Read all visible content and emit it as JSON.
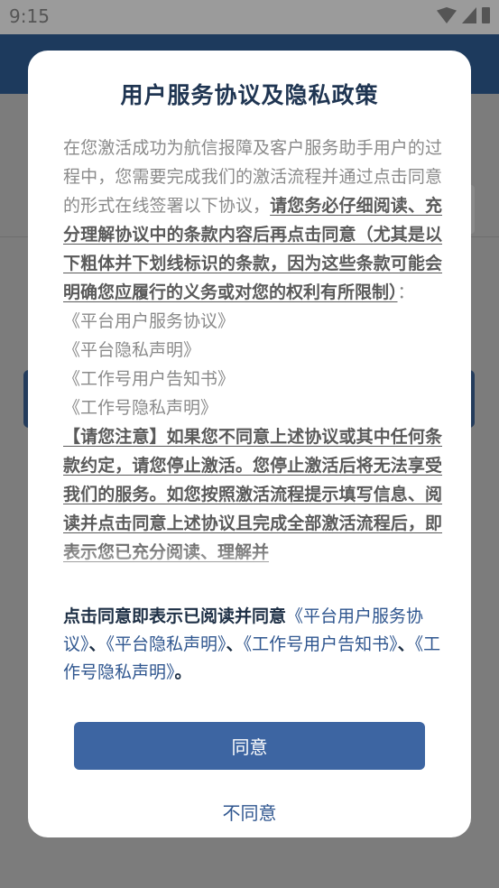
{
  "status_bar": {
    "time": "9:15"
  },
  "dialog": {
    "title": "用户服务协议及隐私政策",
    "intro": "在您激活成功为航信报障及客户服务助手用户的过程中，您需要完成我们的激活流程并通过点击同意的形式在线签署以下协议，",
    "intro_strong": "请您务必仔细阅读、充分理解协议中的条款内容后再点击同意（尤其是以下粗体并下划线标识的条款，因为这些条款可能会明确您应履行的义务或对您的权利有所限制）",
    "intro_tail": "：",
    "agreements": [
      "《平台用户服务协议》",
      "《平台隐私声明》",
      "《工作号用户告知书》",
      "《工作号隐私声明》"
    ],
    "notice_strong": "【请您注意】如果您不同意上述协议或其中任何条款约定，请您停止激活。您停止激活后将无法享受我们的服务。如您按照激活流程提示填写信息、阅读并点击同意上述协议且完成全部激活流程后，即表示您已充分阅读、理解并",
    "summary": {
      "lead": "点击同意即表示已阅读并同意",
      "links": [
        "《平台用户服务协议》",
        "《平台隐私声明》",
        "《工作号用户告知书》",
        "《工作号隐私声明》"
      ],
      "separator": "、",
      "end": "。"
    },
    "agree_label": "同意",
    "disagree_label": "不同意"
  },
  "colors": {
    "accent": "#3d65a2",
    "link": "#2f568f",
    "title": "#1f3552",
    "appbar": "#1d3a5d"
  }
}
